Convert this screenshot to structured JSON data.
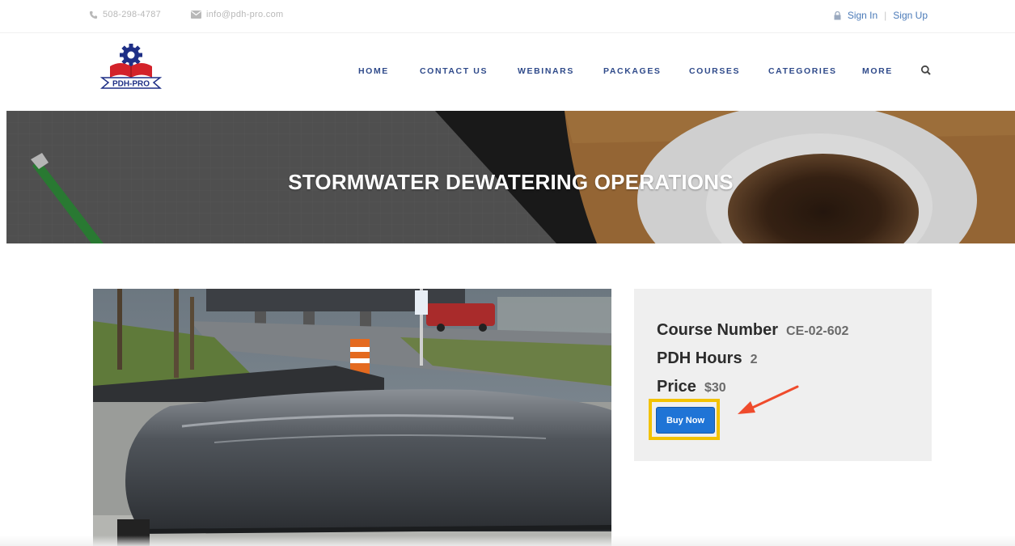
{
  "topbar": {
    "phone": "508-298-4787",
    "email": "info@pdh-pro.com",
    "sign_in": "Sign In",
    "separator": "|",
    "sign_up": "Sign Up"
  },
  "logo": {
    "text": "PDH-PRO"
  },
  "nav": {
    "items": [
      "HOME",
      "CONTACT US",
      "WEBINARS",
      "PACKAGES",
      "COURSES",
      "CATEGORIES",
      "MORE"
    ]
  },
  "hero": {
    "title": "STORMWATER DEWATERING OPERATIONS"
  },
  "course": {
    "number_label": "Course Number",
    "number_value": "CE-02-602",
    "hours_label": "PDH Hours",
    "hours_value": "2",
    "price_label": "Price",
    "price_value": "$30",
    "buy_label": "Buy Now"
  },
  "colors": {
    "nav_text": "#2f4a8a",
    "button": "#1f74d6",
    "highlight": "#f2c200",
    "arrow": "#ef4b2c"
  }
}
